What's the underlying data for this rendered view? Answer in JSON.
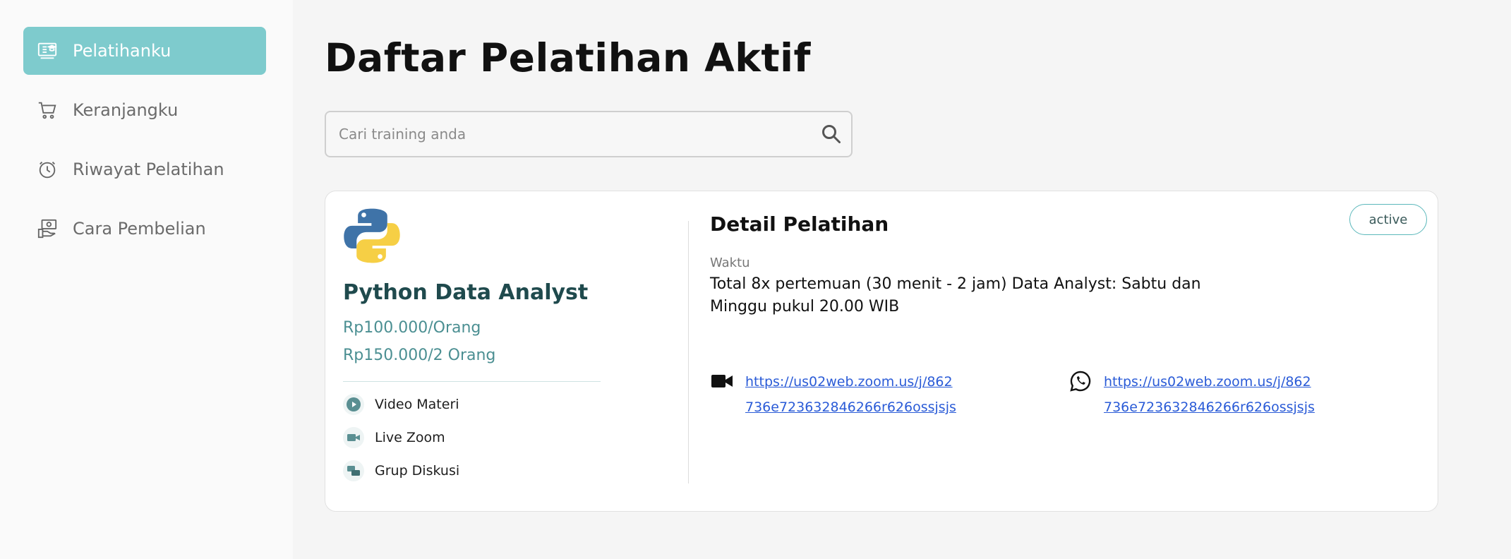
{
  "sidebar": {
    "items": [
      {
        "label": "Pelatihanku",
        "icon": "training-icon",
        "active": true
      },
      {
        "label": "Keranjangku",
        "icon": "cart-icon",
        "active": false
      },
      {
        "label": "Riwayat Pelatihan",
        "icon": "history-icon",
        "active": false
      },
      {
        "label": "Cara Pembelian",
        "icon": "payment-hand-icon",
        "active": false
      }
    ]
  },
  "main": {
    "title": "Daftar Pelatihan Aktif",
    "search": {
      "placeholder": "Cari training anda",
      "value": ""
    },
    "card": {
      "logo": "python-logo",
      "course_title": "Python Data Analyst",
      "prices": [
        "Rp100.000/Orang",
        "Rp150.000/2 Orang"
      ],
      "features": [
        {
          "label": "Video Materi",
          "icon": "play-icon"
        },
        {
          "label": "Live Zoom",
          "icon": "video-camera-icon"
        },
        {
          "label": "Grup Diskusi",
          "icon": "chat-group-icon"
        }
      ],
      "status": "active",
      "detail": {
        "title": "Detail Pelatihan",
        "waktu_label": "Waktu",
        "waktu_text": "Total 8x pertemuan (30 menit - 2 jam) Data Analyst: Sabtu dan Minggu pukul 20.00 WIB",
        "zoom_link": "https://us02web.zoom.us/j/862736e723632846266r626ossjsjs",
        "whatsapp_link": "https://us02web.zoom.us/j/862736e723632846266r626ossjsjs"
      }
    }
  },
  "colors": {
    "accent": "#7ecbcd",
    "title_dark_teal": "#1f4a4d",
    "price_teal": "#4b8f92",
    "link_blue": "#2a5bd7"
  }
}
